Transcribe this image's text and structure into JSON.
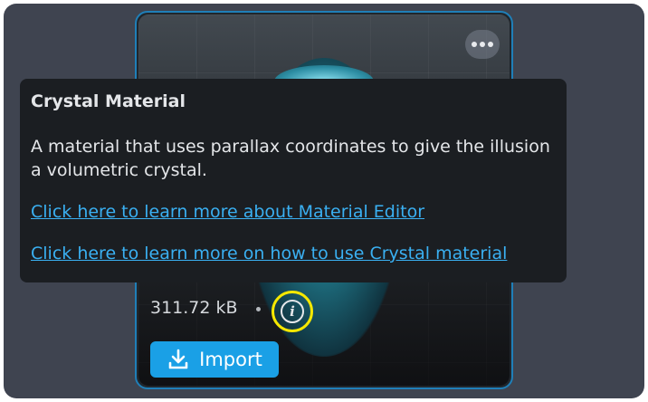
{
  "asset_card": {
    "file_size": "311.72 kB",
    "import_label": "Import"
  },
  "tooltip": {
    "title": "Crystal Material",
    "description": "A material that uses parallax coordinates to give the illusion a volumetric crystal.",
    "link_material_editor": "Click here to learn more about Material Editor",
    "link_crystal_material": "Click here to learn more on how to use Crystal material"
  },
  "colors": {
    "accent": "#1aa0e6",
    "card_border": "#1f7fb8",
    "highlight_ring": "#f5e800",
    "link": "#3ab0f2"
  },
  "icons": [
    "more-options-icon",
    "info-icon",
    "download-icon"
  ]
}
